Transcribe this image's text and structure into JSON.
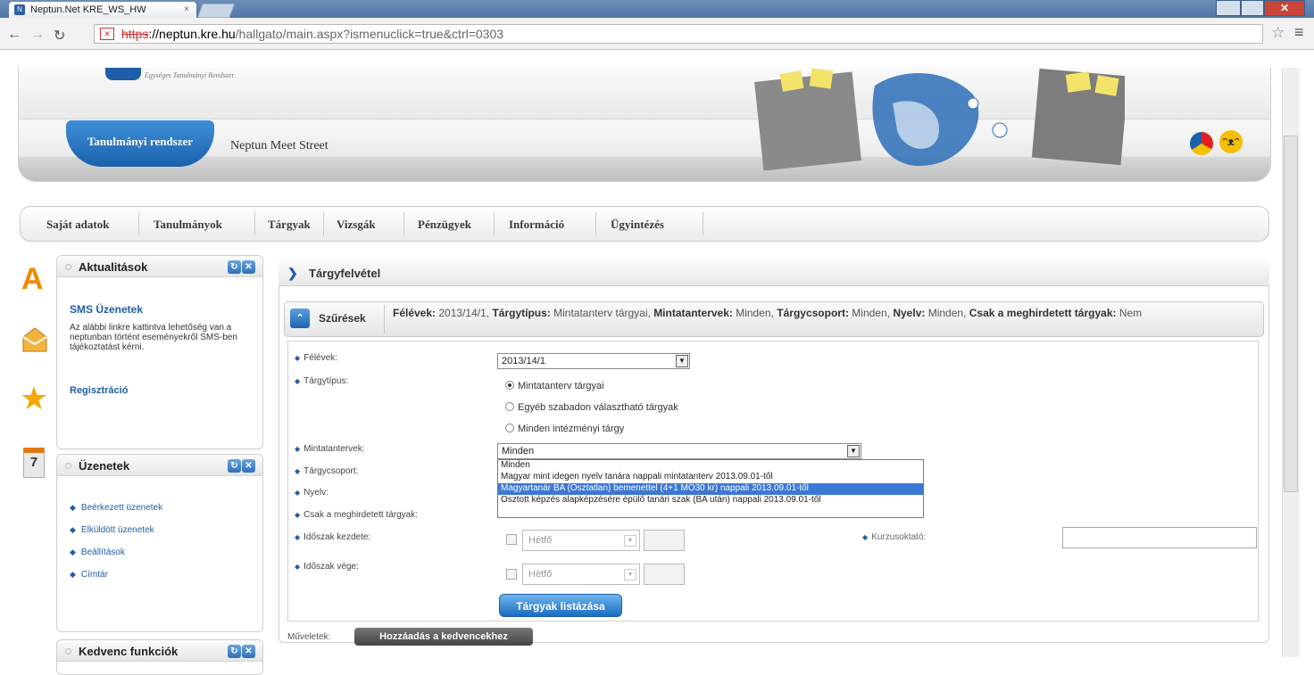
{
  "browser": {
    "tab_title": "Neptun.Net KRE_WS_HW",
    "tab_close": "×",
    "url_protocol": "https",
    "url_host": "://neptun.kre.hu",
    "url_path": "/hallgato/main.aspx?ismenuclick=true&ctrl=0303"
  },
  "header": {
    "logo_subtitle": "Egységes Tanulmányi Rendszer",
    "tab_study": "Tanulmányi rendszer",
    "tab_meet": "Neptun Meet Street"
  },
  "nav": {
    "items": [
      "Saját adatok",
      "Tanulmányok",
      "Tárgyak",
      "Vizsgák",
      "Pénzügyek",
      "Információ",
      "Ügyintézés"
    ]
  },
  "sidebar": {
    "news": {
      "title": "Aktualitások",
      "sms_title": "SMS Üzenetek",
      "sms_text": "Az alábbi linkre kattintva lehetőség van a neptunban történt eseményekről SMS-ben tájékoztatást kérni.",
      "sms_link": "Regisztráció"
    },
    "messages": {
      "title": "Üzenetek",
      "items": [
        "Beérkezett üzenetek",
        "Elküldött üzenetek",
        "Beállítások",
        "Címtár"
      ]
    },
    "favorites": {
      "title": "Kedvenc funkciók"
    },
    "calendar_day": "7"
  },
  "main": {
    "title": "Tárgyfelvétel",
    "filter": {
      "label": "Szűrések",
      "summary_semesters_label": "Félévek:",
      "summary_semesters": "2013/14/1,",
      "summary_type_label": "Tárgytípus:",
      "summary_type": "Mintatanterv tárgyai,",
      "summary_curricula_label": "Mintatantervek:",
      "summary_curricula": "Minden,",
      "summary_group_label": "Tárgycsoport:",
      "summary_group": "Minden,",
      "summary_lang_label": "Nyelv:",
      "summary_lang": "Minden,",
      "summary_only_label": "Csak a meghirdetett tárgyak:",
      "summary_only": "Nem"
    },
    "form": {
      "semester_label": "Félévek:",
      "semester_value": "2013/14/1",
      "type_label": "Tárgytípus:",
      "type_options": [
        "Mintatanterv tárgyai",
        "Egyéb szabadon választható tárgyak",
        "Minden intézményi tárgy"
      ],
      "curricula_label": "Mintatantervek:",
      "curricula_value": "Minden",
      "curricula_options": [
        "Minden",
        "Magyar mint idegen nyelv tanára nappali mintatanterv 2013.09.01-től",
        "Magyartanár BA (Osztatlan) bemenettel (4+1 MO30 kr) nappali 2013.09.01-től",
        "Osztott képzés alapképzésére épülő tanári szak (BA után) nappali 2013.09.01-től"
      ],
      "group_label": "Tárgycsoport:",
      "lang_label": "Nyelv:",
      "only_label": "Csak a meghirdetett tárgyak:",
      "start_label": "Időszak kezdete:",
      "end_label": "Időszak vége:",
      "day_value": "Hétfő",
      "teacher_label": "Kurzusoktató:",
      "list_button": "Tárgyak listázása",
      "ops_label": "Műveletek:",
      "fav_button": "Hozzáadás a kedvencekhez"
    }
  }
}
